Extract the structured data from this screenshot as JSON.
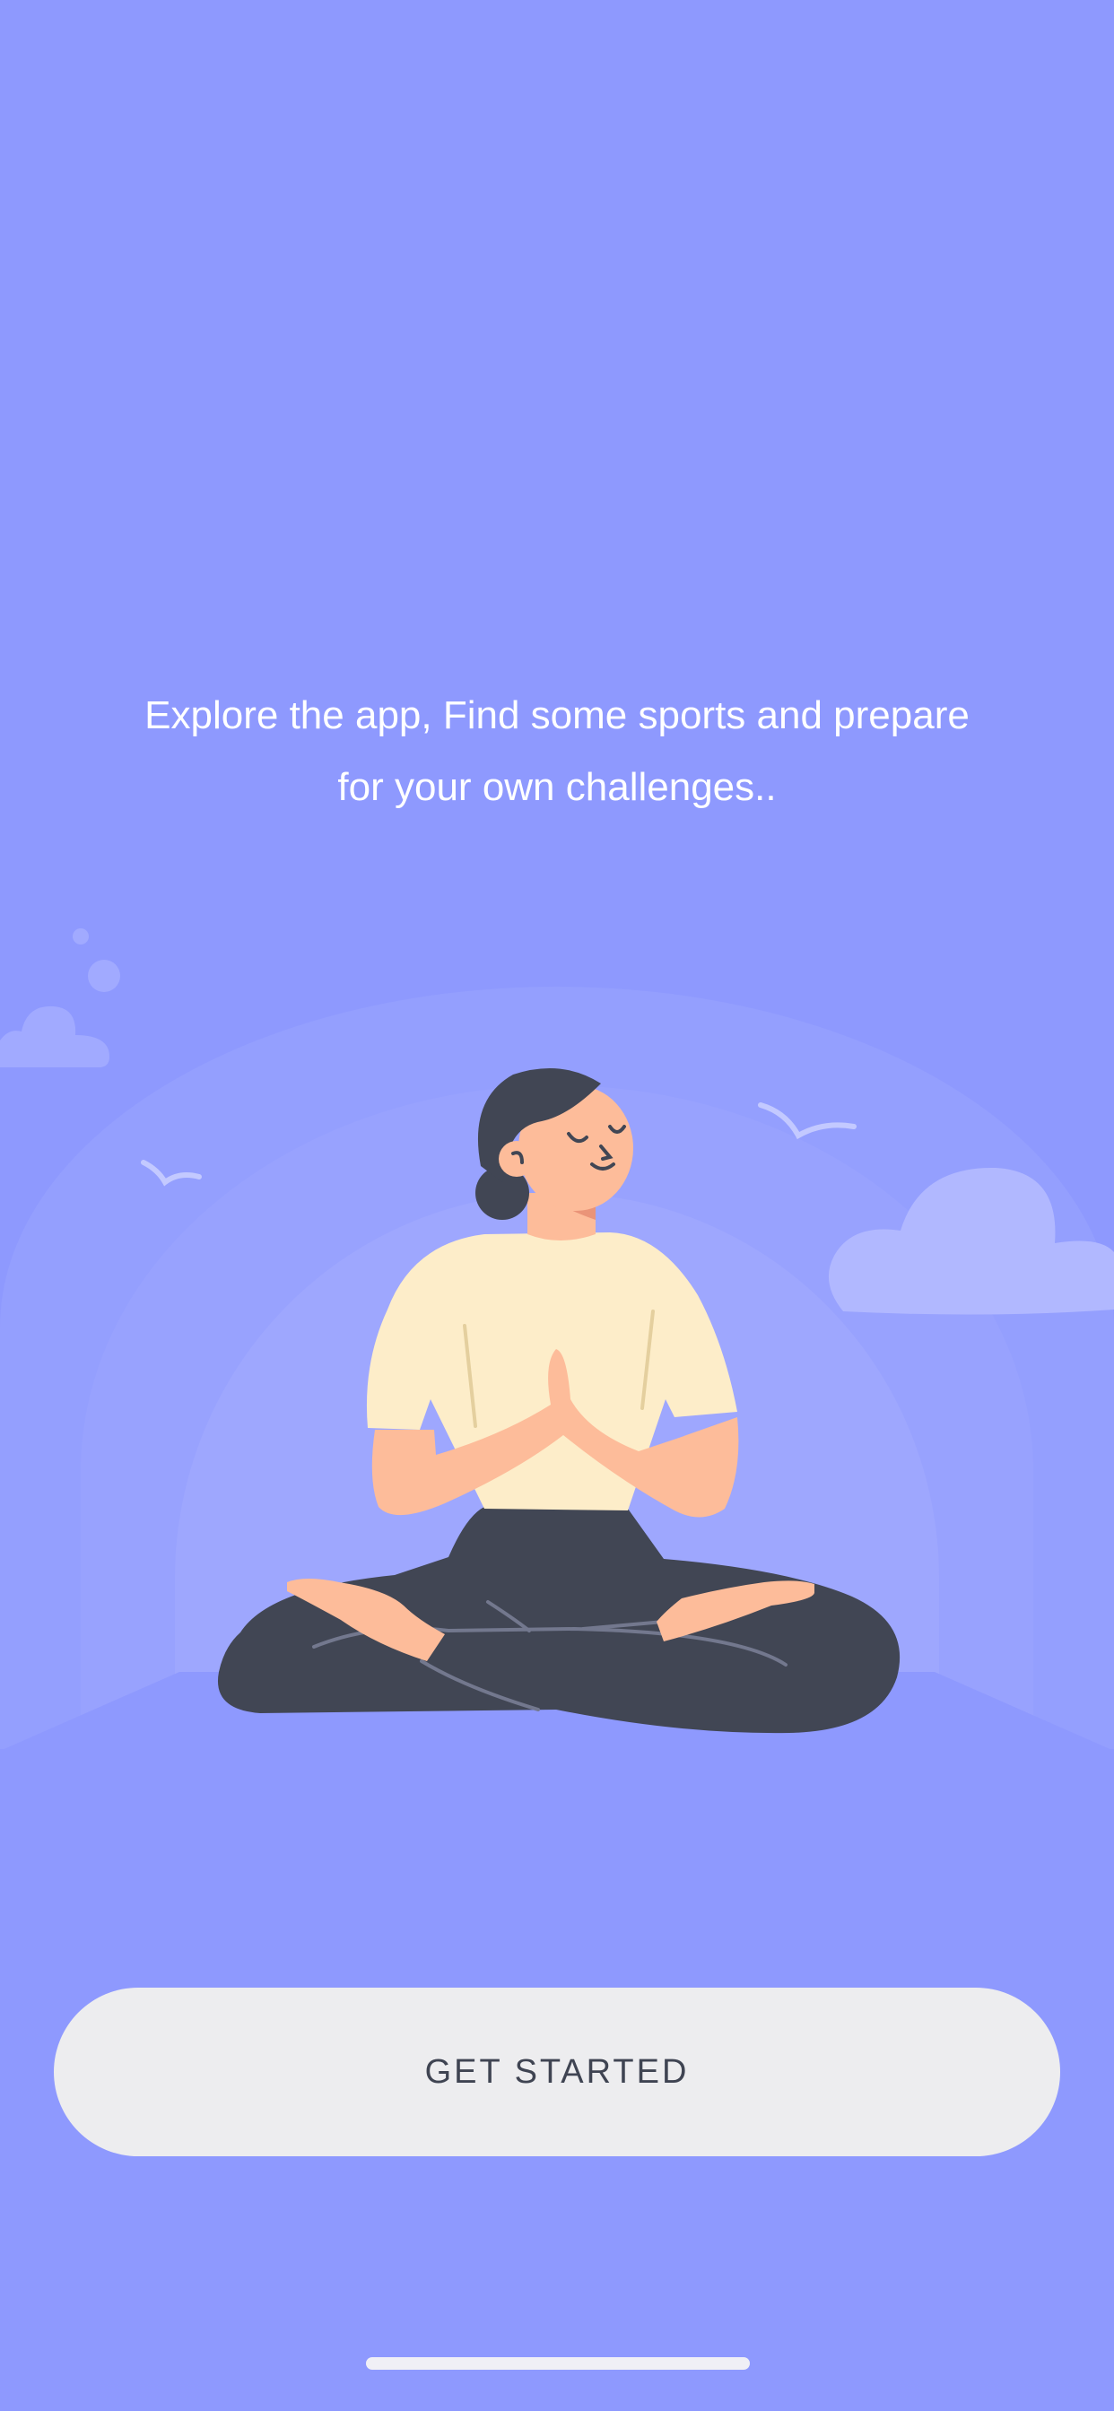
{
  "onboarding": {
    "intro_line_1": "Explore the app, Find some sports and prepare",
    "intro_line_2": "for your own challenges..",
    "illustration": "person-meditating-lotus-pose",
    "cta_label": "GET STARTED"
  },
  "colors": {
    "background": "#8e99fe",
    "button_bg": "#ededef",
    "button_text": "#3f4452",
    "shirt": "#fdedc9",
    "skin": "#fdbc9a",
    "hair_pants": "#414654"
  }
}
